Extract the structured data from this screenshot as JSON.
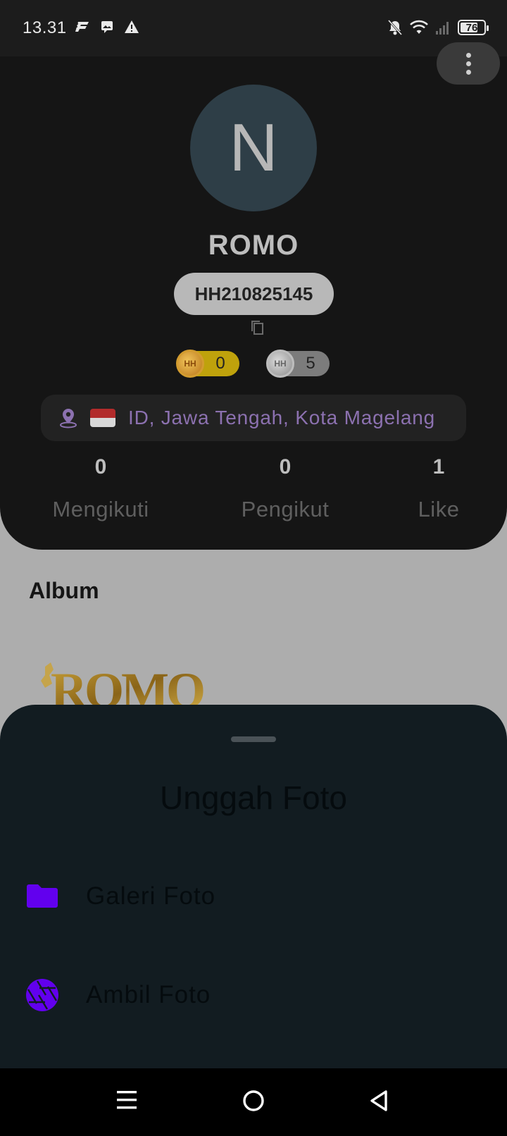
{
  "status_bar": {
    "time": "13.31",
    "battery": "76",
    "left_icons": [
      "fastlane-icon",
      "photo-message-icon",
      "warning-icon"
    ],
    "right_icons": [
      "bell-off-icon",
      "wifi-icon",
      "signal-icon",
      "battery-icon"
    ]
  },
  "profile": {
    "avatar_initial": "N",
    "name": "ROMO",
    "user_id": "HH210825145",
    "gold_coins": "0",
    "silver_coins": "5",
    "location": "ID, Jawa Tengah, Kota Magelang",
    "stats": [
      {
        "count": "0",
        "label": "Mengikuti"
      },
      {
        "count": "0",
        "label": "Pengikut"
      },
      {
        "count": "1",
        "label": "Like"
      }
    ]
  },
  "album": {
    "title": "Album",
    "logo_text": "ROMO"
  },
  "upload_sheet": {
    "title": "Unggah Foto",
    "options": [
      {
        "label": "Galeri Foto",
        "icon": "folder-icon"
      },
      {
        "label": "Ambil Foto",
        "icon": "camera-shutter-icon"
      }
    ]
  },
  "colors": {
    "accent": "#6200ee",
    "card_bg": "#151515",
    "sheet_bg": "#121c21",
    "location_text": "#8c71b0"
  }
}
